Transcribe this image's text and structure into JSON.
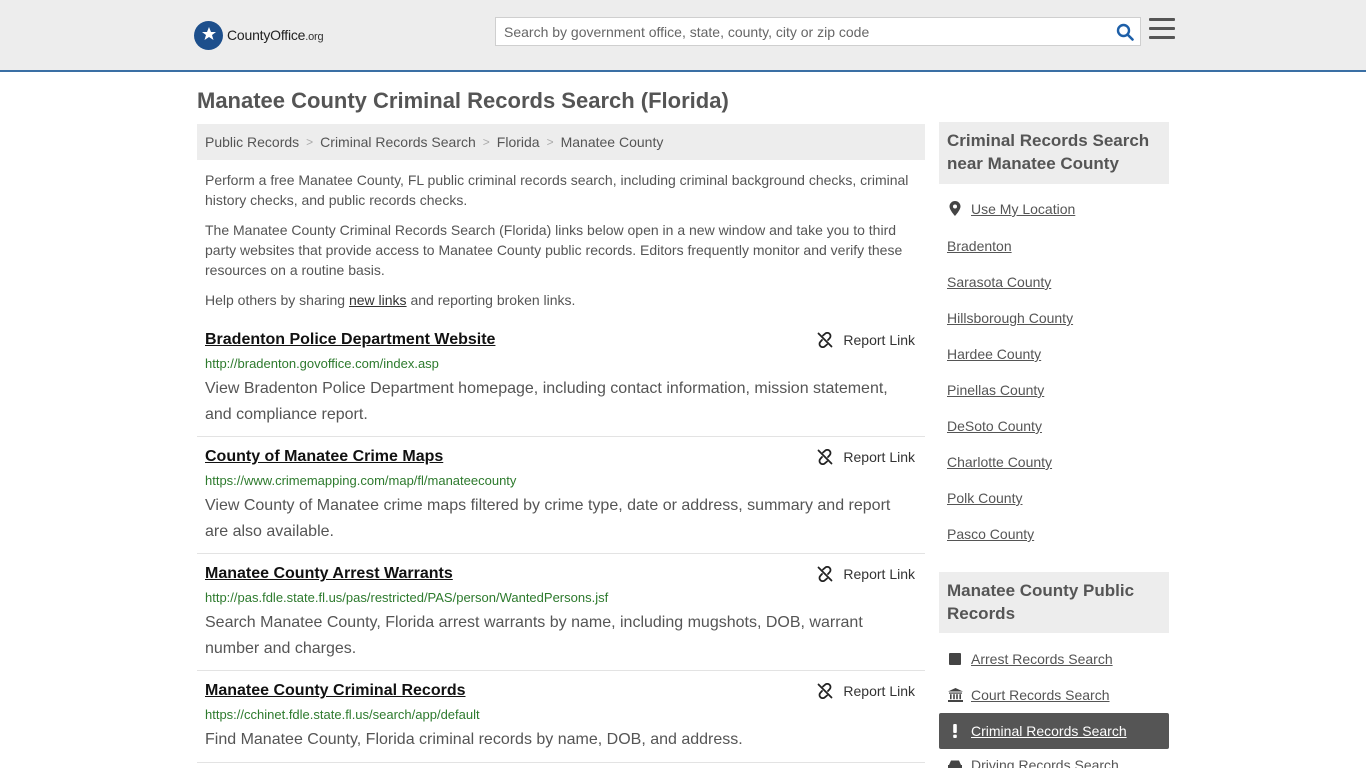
{
  "header": {
    "logo_main": "CountyOffice",
    "logo_suffix": ".org",
    "search_placeholder": "Search by government office, state, county, city or zip code"
  },
  "page": {
    "title": "Manatee County Criminal Records Search (Florida)"
  },
  "breadcrumb": [
    "Public Records",
    "Criminal Records Search",
    "Florida",
    "Manatee County"
  ],
  "intro": {
    "p1": "Perform a free Manatee County, FL public criminal records search, including criminal background checks, criminal history checks, and public records checks.",
    "p2": "The Manatee County Criminal Records Search (Florida) links below open in a new window and take you to third party websites that provide access to Manatee County public records. Editors frequently monitor and verify these resources on a routine basis.",
    "p3_before": "Help others by sharing ",
    "p3_link": "new links",
    "p3_after": " and reporting broken links."
  },
  "report_label": "Report Link",
  "listings": [
    {
      "title": "Bradenton Police Department Website",
      "url": "http://bradenton.govoffice.com/index.asp",
      "desc": "View Bradenton Police Department homepage, including contact information, mission statement, and compliance report."
    },
    {
      "title": "County of Manatee Crime Maps",
      "url": "https://www.crimemapping.com/map/fl/manateecounty",
      "desc": "View County of Manatee crime maps filtered by crime type, date or address, summary and report are also available."
    },
    {
      "title": "Manatee County Arrest Warrants",
      "url": "http://pas.fdle.state.fl.us/pas/restricted/PAS/person/WantedPersons.jsf",
      "desc": "Search Manatee County, Florida arrest warrants by name, including mugshots, DOB, warrant number and charges."
    },
    {
      "title": "Manatee County Criminal Records",
      "url": "https://cchinet.fdle.state.fl.us/search/app/default",
      "desc": "Find Manatee County, Florida criminal records by name, DOB, and address."
    }
  ],
  "sidebar": {
    "nearby_heading": "Criminal Records Search near Manatee County",
    "use_location": "Use My Location",
    "nearby": [
      "Bradenton",
      "Sarasota County",
      "Hillsborough County",
      "Hardee County",
      "Pinellas County",
      "DeSoto County",
      "Charlotte County",
      "Polk County",
      "Pasco County"
    ],
    "public_heading": "Manatee County Public Records",
    "public_links": [
      {
        "label": "Arrest Records Search",
        "icon": "square-icon"
      },
      {
        "label": "Court Records Search",
        "icon": "courthouse-icon"
      },
      {
        "label": "Criminal Records Search",
        "icon": "exclamation-icon",
        "active": true
      },
      {
        "label": "Driving Records Search",
        "icon": "car-icon"
      }
    ]
  },
  "colors": {
    "accent": "#3a6fa4",
    "url_green": "#2d7a2d",
    "active_bg": "#555555",
    "panel_bg": "#ededed"
  }
}
